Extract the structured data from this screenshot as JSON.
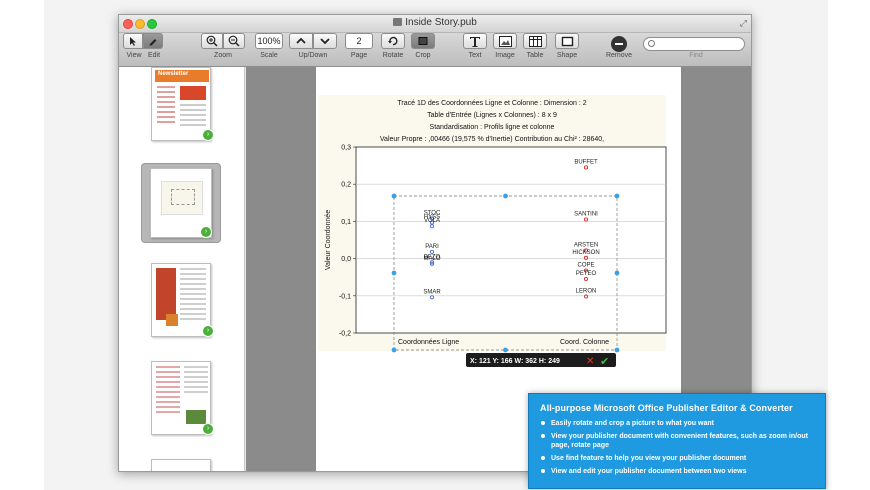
{
  "window": {
    "title": "Inside Story.pub"
  },
  "toolbar": {
    "view_label": "View",
    "edit_label": "Edit",
    "zoom_label": "Zoom",
    "scale_value": "100%",
    "scale_label": "Scale",
    "updown_label": "Up/Down",
    "page_value": "2",
    "page_label": "Page",
    "rotate_label": "Rotate",
    "crop_label": "Crop",
    "text_label": "Text",
    "image_label": "Image",
    "table_label": "Table",
    "shape_label": "Shape",
    "remove_label": "Remove",
    "find_label": "Find"
  },
  "sidebar": {
    "thumb1_title": "Newsletter"
  },
  "chart_data": {
    "type": "scatter",
    "title_lines": [
      "Tracé 1D des Coordonnées Ligne et Colonne : Dimension : 2",
      "Table d'Entrée (Lignes x Colonnes) : 8 x 9",
      "Standardisation : Profils ligne et colonne",
      "Valeur Propre : ,00466 (19,575 % d'Inertie) Contribution au Chi² : 28640,"
    ],
    "ylabel": "Valeur Coordonnée",
    "xlabel_left": "Coordonnées Ligne",
    "xlabel_right": "Coord. Colonne",
    "ylim": [
      -0.2,
      0.3
    ],
    "yticks": [
      "0,3",
      "0,2",
      "0,1",
      "0,0",
      "-0,1",
      "-0,2"
    ],
    "series": [
      {
        "points": [
          {
            "label": "STOC",
            "y": 0.108
          },
          {
            "label": "HYSS",
            "y": 0.097
          },
          {
            "label": "VOLA",
            "y": 0.087
          },
          {
            "label": "PARI",
            "y": 0.018
          },
          {
            "label": "BEZO",
            "y": -0.01
          },
          {
            "label": "MALO",
            "y": -0.014
          },
          {
            "label": "SMAR",
            "y": -0.104
          }
        ]
      },
      {
        "points": [
          {
            "label": "BUFFET",
            "y": 0.245
          },
          {
            "label": "SANTINI",
            "y": 0.105
          },
          {
            "label": "ARSTEN",
            "y": 0.022
          },
          {
            "label": "HICKSON",
            "y": 0.002
          },
          {
            "label": "COPE",
            "y": -0.032
          },
          {
            "label": "PETEO",
            "y": -0.055
          },
          {
            "label": "LERON",
            "y": -0.102
          }
        ]
      }
    ]
  },
  "selection": {
    "readout": "X: 121 Y: 166 W: 362 H: 249"
  },
  "promo": {
    "title": "All-purpose Microsoft Office Publisher Editor & Converter",
    "items": [
      "Easily rotate and crop a picture to what you want",
      "View your publisher document with convenient features, such as zoom in/out page, rotate page",
      "Use find feature to help you view your publisher document",
      "View and edit your publisher document between two views"
    ]
  },
  "colors": {
    "accent": "#1f9ae0",
    "selection": "#3aa0e8",
    "point_blue": "#4a6fd6",
    "point_red": "#d23030"
  }
}
